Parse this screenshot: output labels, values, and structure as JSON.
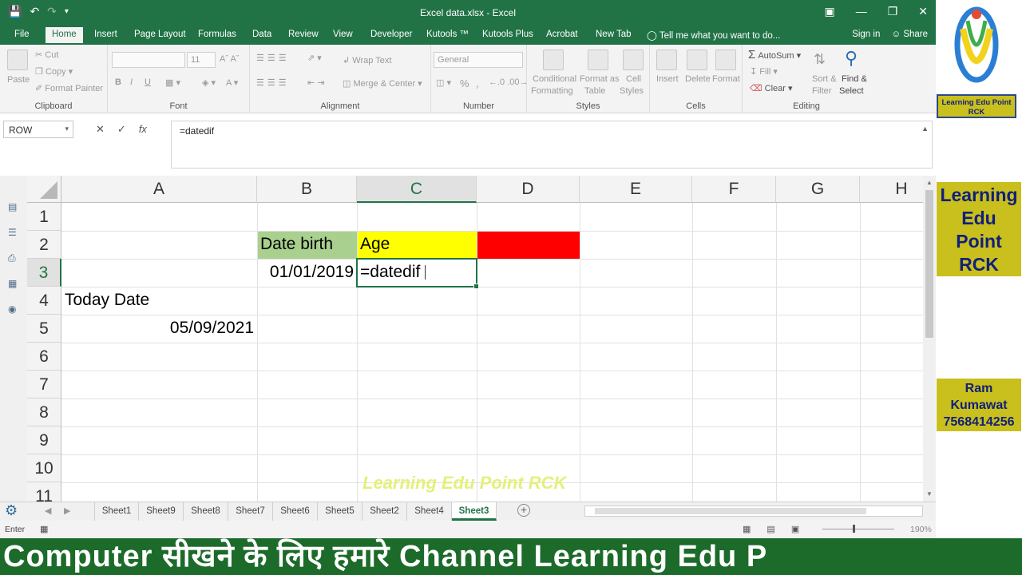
{
  "app": {
    "title": "Excel data.xlsx - Excel",
    "qat_icons": [
      "save-icon",
      "undo-icon",
      "redo-icon",
      "customize-icon"
    ],
    "signin": "Sign in",
    "share": "Share",
    "tell_me": "Tell me what you want to do..."
  },
  "tabs": [
    "File",
    "Home",
    "Insert",
    "Page Layout",
    "Formulas",
    "Data",
    "Review",
    "View",
    "Developer",
    "Kutools ™",
    "Kutools Plus",
    "Acrobat",
    "New Tab"
  ],
  "active_tab": "Home",
  "ribbon": {
    "clipboard": {
      "label": "Clipboard",
      "paste": "Paste",
      "cut": "Cut",
      "copy": "Copy",
      "format_painter": "Format Painter"
    },
    "font": {
      "label": "Font",
      "size": "11",
      "bold": "B",
      "italic": "I",
      "underline": "U"
    },
    "alignment": {
      "label": "Alignment",
      "wrap_text": "Wrap Text",
      "merge_center": "Merge & Center"
    },
    "number": {
      "label": "Number",
      "format": "General",
      "percent": "%",
      "comma": ","
    },
    "styles": {
      "label": "Styles",
      "conditional": "Conditional\nFormatting",
      "conditional_l1": "Conditional",
      "conditional_l2": "Formatting",
      "format_as_l1": "Format as",
      "format_as_l2": "Table",
      "cell_styles_l1": "Cell",
      "cell_styles_l2": "Styles"
    },
    "cells": {
      "label": "Cells",
      "insert": "Insert",
      "delete": "Delete",
      "format": "Format"
    },
    "editing": {
      "label": "Editing",
      "autosum": "AutoSum",
      "fill": "Fill",
      "clear": "Clear",
      "sort_l1": "Sort &",
      "sort_l2": "Filter",
      "find_l1": "Find &",
      "find_l2": "Select"
    }
  },
  "formula_bar": {
    "name_box": "ROW",
    "cancel": "✕",
    "enter": "✓",
    "fx": "fx",
    "formula": "=datedif"
  },
  "grid": {
    "columns": [
      "A",
      "B",
      "C",
      "D",
      "E",
      "F",
      "G",
      "H"
    ],
    "selected_column": "C",
    "rows": [
      "1",
      "2",
      "3",
      "4",
      "5",
      "6",
      "7",
      "8",
      "9",
      "10",
      "11"
    ],
    "selected_row": "3",
    "cells": {
      "B2": "Date birth",
      "C2": "Age",
      "B3": "01/01/2019",
      "C3": "=datedif",
      "A4": "Today Date",
      "A5": "05/09/2021"
    },
    "fills": {
      "B2": "#a9d08e",
      "C2": "#ffff00",
      "D2": "#ff0000"
    },
    "watermark": "Learning Edu Point RCK"
  },
  "sheets": [
    "Sheet1",
    "Sheet9",
    "Sheet8",
    "Sheet7",
    "Sheet6",
    "Sheet5",
    "Sheet2",
    "Sheet4",
    "Sheet3"
  ],
  "active_sheet": "Sheet3",
  "status": {
    "mode": "Enter",
    "zoom": "190%"
  },
  "promo": {
    "logo_text_l1": "Learning Edu Point",
    "logo_text_l2": "RCK",
    "box1": [
      "Learning",
      "Edu",
      "Point",
      "RCK"
    ],
    "box2": [
      "Ram",
      "Kumawat",
      "7568414256"
    ]
  },
  "banner": "Computer सीखने के लिए हमारे  Channel Learning Edu P"
}
